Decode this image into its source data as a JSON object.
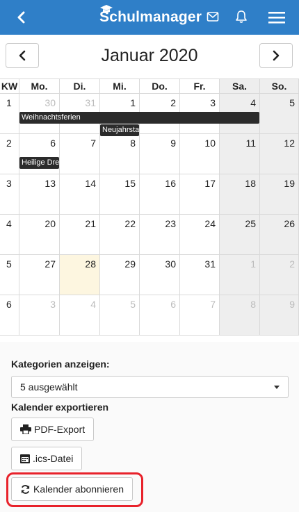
{
  "header": {
    "brand": "Schulmanager"
  },
  "calendar": {
    "month_title": "Januar 2020",
    "headers": [
      "KW",
      "Mo.",
      "Di.",
      "Mi.",
      "Do.",
      "Fr.",
      "Sa.",
      "So."
    ],
    "weeks": [
      {
        "kw": "1",
        "days": [
          "30",
          "31",
          "1",
          "2",
          "3",
          "4",
          "5"
        ]
      },
      {
        "kw": "2",
        "days": [
          "6",
          "7",
          "8",
          "9",
          "10",
          "11",
          "12"
        ]
      },
      {
        "kw": "3",
        "days": [
          "13",
          "14",
          "15",
          "16",
          "17",
          "18",
          "19"
        ]
      },
      {
        "kw": "4",
        "days": [
          "20",
          "21",
          "22",
          "23",
          "24",
          "25",
          "26"
        ]
      },
      {
        "kw": "5",
        "days": [
          "27",
          "28",
          "29",
          "30",
          "31",
          "1",
          "2"
        ]
      },
      {
        "kw": "6",
        "days": [
          "3",
          "4",
          "5",
          "6",
          "7",
          "8",
          "9"
        ]
      }
    ],
    "events": [
      {
        "title": "Weihnachtsferien"
      },
      {
        "title": "Neujahrstag"
      },
      {
        "title": "Heilige Drei Könige"
      }
    ]
  },
  "filters": {
    "categories_label": "Kategorien anzeigen:",
    "selected_value": "5 ausgewählt",
    "export_label": "Kalender exportieren"
  },
  "buttons": {
    "pdf_export": "PDF-Export",
    "ics_file": ".ics-Datei",
    "subscribe": "Kalender abonnieren"
  },
  "colors": {
    "topbar": "#2f7fc8",
    "event": "#2b2b2b",
    "today": "#fdf6e0",
    "weekend": "#eeeeee",
    "highlight": "#e8222b"
  }
}
